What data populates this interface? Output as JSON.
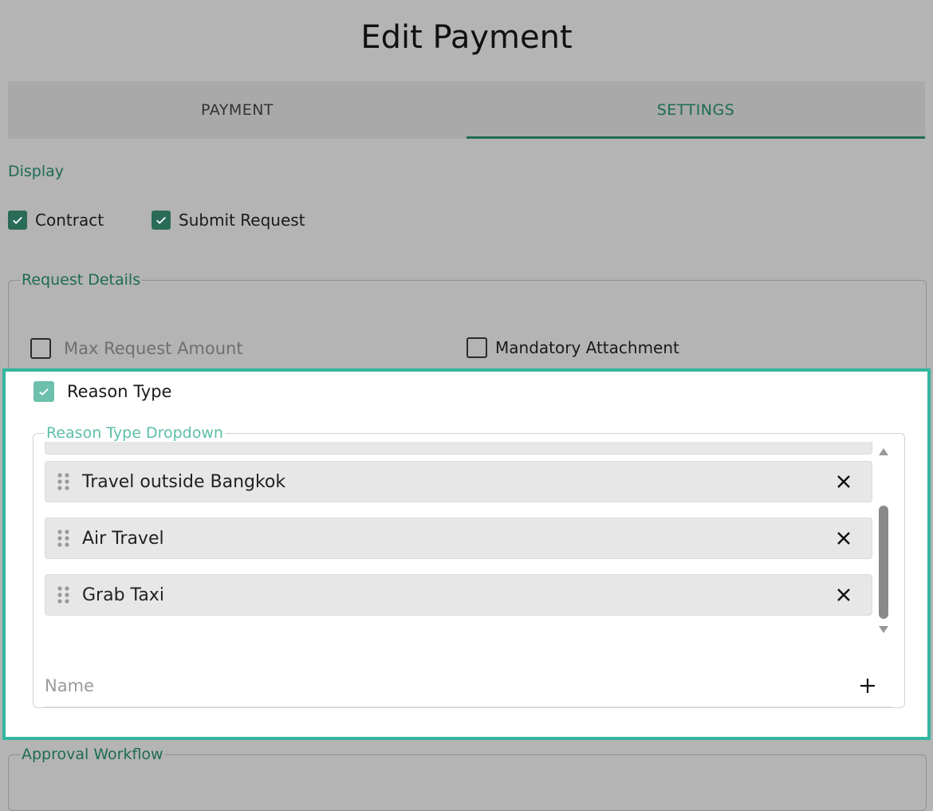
{
  "page": {
    "title": "Edit Payment"
  },
  "tabs": [
    {
      "label": "PAYMENT",
      "active": false
    },
    {
      "label": "SETTINGS",
      "active": true
    }
  ],
  "display": {
    "label": "Display",
    "contract": {
      "label": "Contract",
      "checked": true
    },
    "submit_request": {
      "label": "Submit Request",
      "checked": true
    }
  },
  "request_details": {
    "legend": "Request Details",
    "max_request_amount": {
      "label": "Max Request Amount",
      "checked": false
    },
    "mandatory_attachment": {
      "label": "Mandatory Attachment",
      "checked": false
    },
    "reason_type": {
      "label": "Reason Type",
      "checked": true
    }
  },
  "reason_dropdown": {
    "legend": "Reason Type Dropdown",
    "items": [
      {
        "label": "Travel outside Bangkok"
      },
      {
        "label": "Air Travel"
      },
      {
        "label": "Grab Taxi"
      }
    ],
    "name_placeholder": "Name"
  },
  "approval_workflow": {
    "legend": "Approval Workflow"
  },
  "colors": {
    "accent": "#1e6b55",
    "highlight": "#34b59f",
    "overlay": "#b4b4b4"
  }
}
